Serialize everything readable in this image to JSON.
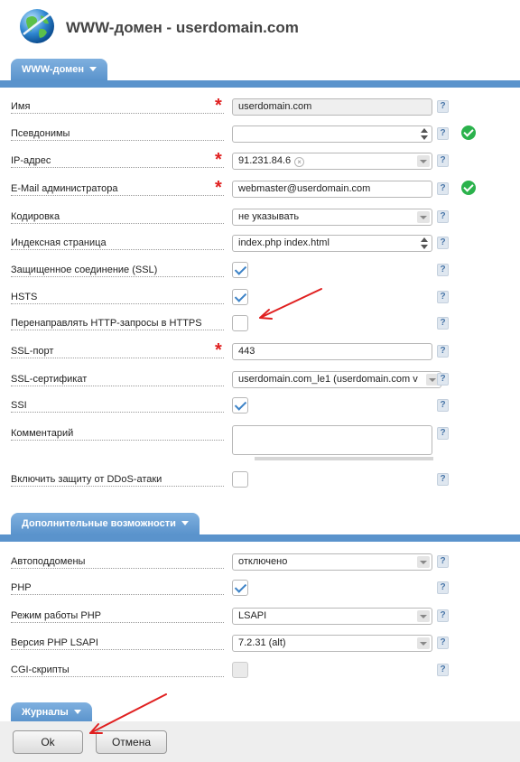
{
  "page": {
    "title": "WWW-домен - userdomain.com"
  },
  "sections": {
    "main": "WWW-домен",
    "extra": "Дополнительные возможности",
    "logs": "Журналы"
  },
  "fields": {
    "name": {
      "label": "Имя",
      "value": "userdomain.com"
    },
    "aliases": {
      "label": "Псевдонимы",
      "value": ""
    },
    "ip": {
      "label": "IP-адрес",
      "value": "91.231.84.6"
    },
    "email": {
      "label": "E-Mail администратора",
      "value": "webmaster@userdomain.com"
    },
    "charset": {
      "label": "Кодировка",
      "value": "не указывать"
    },
    "index": {
      "label": "Индексная страница",
      "value": "index.php index.html"
    },
    "ssl": {
      "label": "Защищенное соединение (SSL)",
      "checked": true
    },
    "hsts": {
      "label": "HSTS",
      "checked": true
    },
    "redirect": {
      "label": "Перенаправлять HTTP-запросы в HTTPS",
      "checked": false
    },
    "ssl_port": {
      "label": "SSL-порт",
      "value": "443"
    },
    "ssl_cert": {
      "label": "SSL-сертификат",
      "value": "userdomain.com_le1 (userdomain.com v"
    },
    "ssi": {
      "label": "SSI",
      "checked": true
    },
    "comment": {
      "label": "Комментарий",
      "value": ""
    },
    "ddos": {
      "label": "Включить защиту от DDoS-атаки",
      "checked": false
    },
    "autosub": {
      "label": "Автоподдомены",
      "value": "отключено"
    },
    "php": {
      "label": "PHP",
      "checked": true
    },
    "php_mode": {
      "label": "Режим работы PHP",
      "value": "LSAPI"
    },
    "php_version": {
      "label": "Версия PHP LSAPI",
      "value": "7.2.31 (alt)"
    },
    "cgi": {
      "label": "CGI-скрипты",
      "checked": false
    }
  },
  "help_glyph": "?",
  "buttons": {
    "ok": "Ok",
    "cancel": "Отмена"
  },
  "icons": {
    "globe": "globe-icon",
    "help": "help-icon",
    "valid": "check-circle-icon",
    "required": "asterisk-icon",
    "caret": "caret-down-icon",
    "arrow": "red-arrow-annotation"
  },
  "colors": {
    "accent": "#5a93cc",
    "valid": "#2bb24c",
    "required": "#e02020",
    "annotation": "#e02020"
  }
}
